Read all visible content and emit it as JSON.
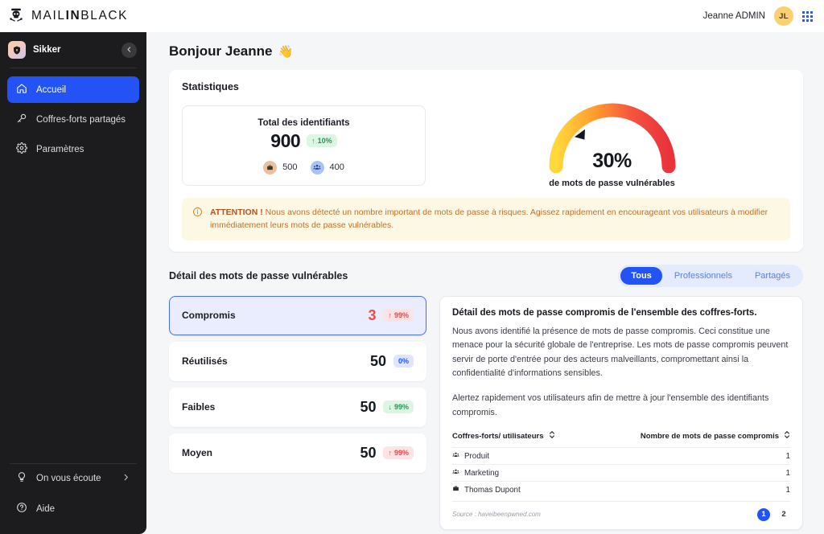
{
  "topbar": {
    "brand_prefix": "MAIL",
    "brand_bold": "IN",
    "brand_suffix": "BLACK",
    "user_name": "Jeanne ADMIN",
    "avatar_initials": "JL",
    "logo_icon": "skull-crossbones-icon",
    "apps_icon": "apps-grid-icon"
  },
  "sidebar": {
    "app_name": "Sikker",
    "app_icon": "shield-icon",
    "collapse_icon": "chevron-left-icon",
    "items": [
      {
        "label": "Accueil",
        "icon": "home-icon",
        "active": true
      },
      {
        "label": "Coffres-forts partagés",
        "icon": "key-icon",
        "active": false
      },
      {
        "label": "Paramètres",
        "icon": "gear-icon",
        "active": false
      }
    ],
    "bottom_items": [
      {
        "label": "On vous écoute",
        "icon": "lightbulb-icon",
        "chevron": "chevron-right-icon"
      },
      {
        "label": "Aide",
        "icon": "help-circle-icon"
      }
    ]
  },
  "main": {
    "greeting": "Bonjour Jeanne",
    "greeting_emoji": "👋",
    "stats_title": "Statistiques",
    "total": {
      "label": "Total des identifiants",
      "value": "900",
      "trend": "10%",
      "trend_arrow": "↑",
      "breakdown": [
        {
          "icon": "briefcase-icon",
          "value": "500"
        },
        {
          "icon": "users-icon",
          "value": "400"
        }
      ]
    },
    "warning": {
      "icon": "info-circle-icon",
      "bold": "ATTENTION !",
      "text": "Nous avons détecté un nombre important de mots de passe à risques. Agissez rapidement en encourageant vos utilisateurs à modifier immédiatement leurs mots de passe vulnérables."
    },
    "section_title": "Détail des mots de passe vulnérables",
    "tabs": [
      {
        "label": "Tous",
        "active": true
      },
      {
        "label": "Professionnels",
        "active": false
      },
      {
        "label": "Partagés",
        "active": false
      }
    ],
    "rows": [
      {
        "label": "Compromis",
        "value": "3",
        "badge": "99%",
        "arrow": "↑",
        "badge_style": "up-red",
        "selected": true
      },
      {
        "label": "Réutilisés",
        "value": "50",
        "badge": "0%",
        "arrow": "",
        "badge_style": "flat-blue",
        "selected": false
      },
      {
        "label": "Faibles",
        "value": "50",
        "badge": "99%",
        "arrow": "↓",
        "badge_style": "down-green",
        "selected": false
      },
      {
        "label": "Moyen",
        "value": "50",
        "badge": "99%",
        "arrow": "↑",
        "badge_style": "up-red",
        "selected": false
      }
    ],
    "detail": {
      "title": "Détail des mots de passe compromis de l'ensemble des coffres-forts.",
      "paragraph1": "Nous avons identifié la présence de mots de passe compromis. Ceci constitue une menace pour la sécurité globale de l'entreprise. Les mots de passe compromis peuvent servir de porte d'entrée pour des acteurs malveillants, compromettant ainsi la confidentialité d'informations sensibles.",
      "paragraph2": "Alertez rapidement vos utilisateurs afin de mettre à jour l'ensemble des identifiants compromis.",
      "table": {
        "columns": [
          "Coffres-forts/ utilisateurs",
          "Nombre de mots de passe compromis"
        ],
        "sort_icon": "sort-updown-icon",
        "rows": [
          {
            "icon": "users-icon",
            "name": "Produit",
            "count": "1"
          },
          {
            "icon": "users-icon",
            "name": "Marketing",
            "count": "1"
          },
          {
            "icon": "briefcase-icon",
            "name": "Thomas Dupont",
            "count": "1"
          }
        ]
      },
      "source": "Source : haveibeenpwned.com",
      "pages": [
        {
          "label": "1",
          "active": true
        },
        {
          "label": "2",
          "active": false
        }
      ]
    }
  },
  "chart_data": {
    "type": "gauge",
    "title": "",
    "value": 30,
    "value_label": "30%",
    "caption": "de mots de passe vulnérables",
    "min": 0,
    "max": 100,
    "unit": "%",
    "needle": true,
    "gradient_stops": [
      "#ffd93b",
      "#ff9b2f",
      "#f5523f",
      "#e8333a"
    ],
    "colors": {
      "start": "#ffd93b",
      "mid": "#ff8a35",
      "end": "#e8333a"
    }
  },
  "colors": {
    "accent": "#2352f5",
    "sidebar_bg": "#1c1c1e",
    "danger": "#ea4b4b",
    "success": "#1f9d4f",
    "warning_bg": "#fdf8e4",
    "warning_text": "#c0702c",
    "avatar_bg": "#fbd070"
  }
}
